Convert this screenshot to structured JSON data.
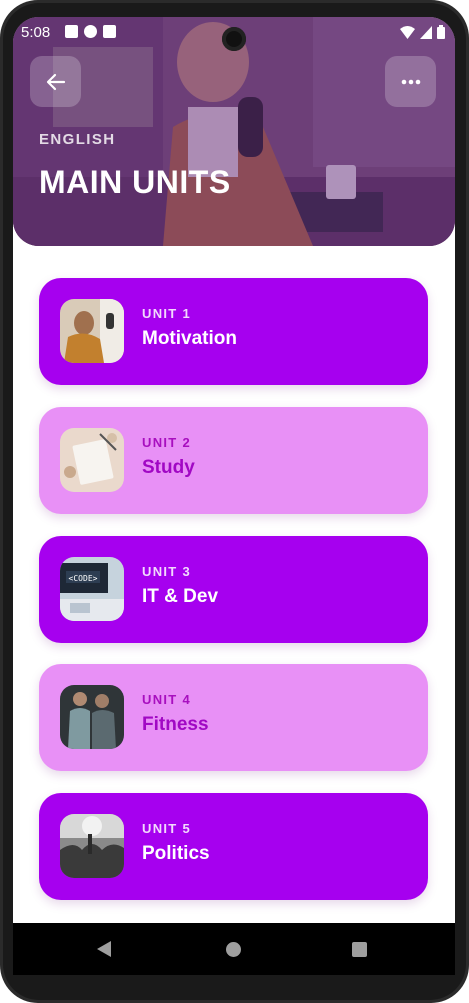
{
  "status_bar": {
    "time": "5:08"
  },
  "header": {
    "eyebrow": "ENGLISH",
    "title": "MAIN UNITS"
  },
  "units": [
    {
      "kicker": "UNIT 1",
      "name": "Motivation",
      "style": "dark"
    },
    {
      "kicker": "UNIT 2",
      "name": "Study",
      "style": "light"
    },
    {
      "kicker": "UNIT 3",
      "name": "IT & Dev",
      "style": "dark"
    },
    {
      "kicker": "UNIT 4",
      "name": "Fitness",
      "style": "light"
    },
    {
      "kicker": "UNIT 5",
      "name": "Politics",
      "style": "dark"
    }
  ],
  "colors": {
    "card_dark": "#a600ef",
    "card_light": "#e890f6",
    "text_light_card": "#a108c4"
  },
  "icons": {
    "back": "arrow-left-icon",
    "more": "more-horizontal-icon"
  }
}
